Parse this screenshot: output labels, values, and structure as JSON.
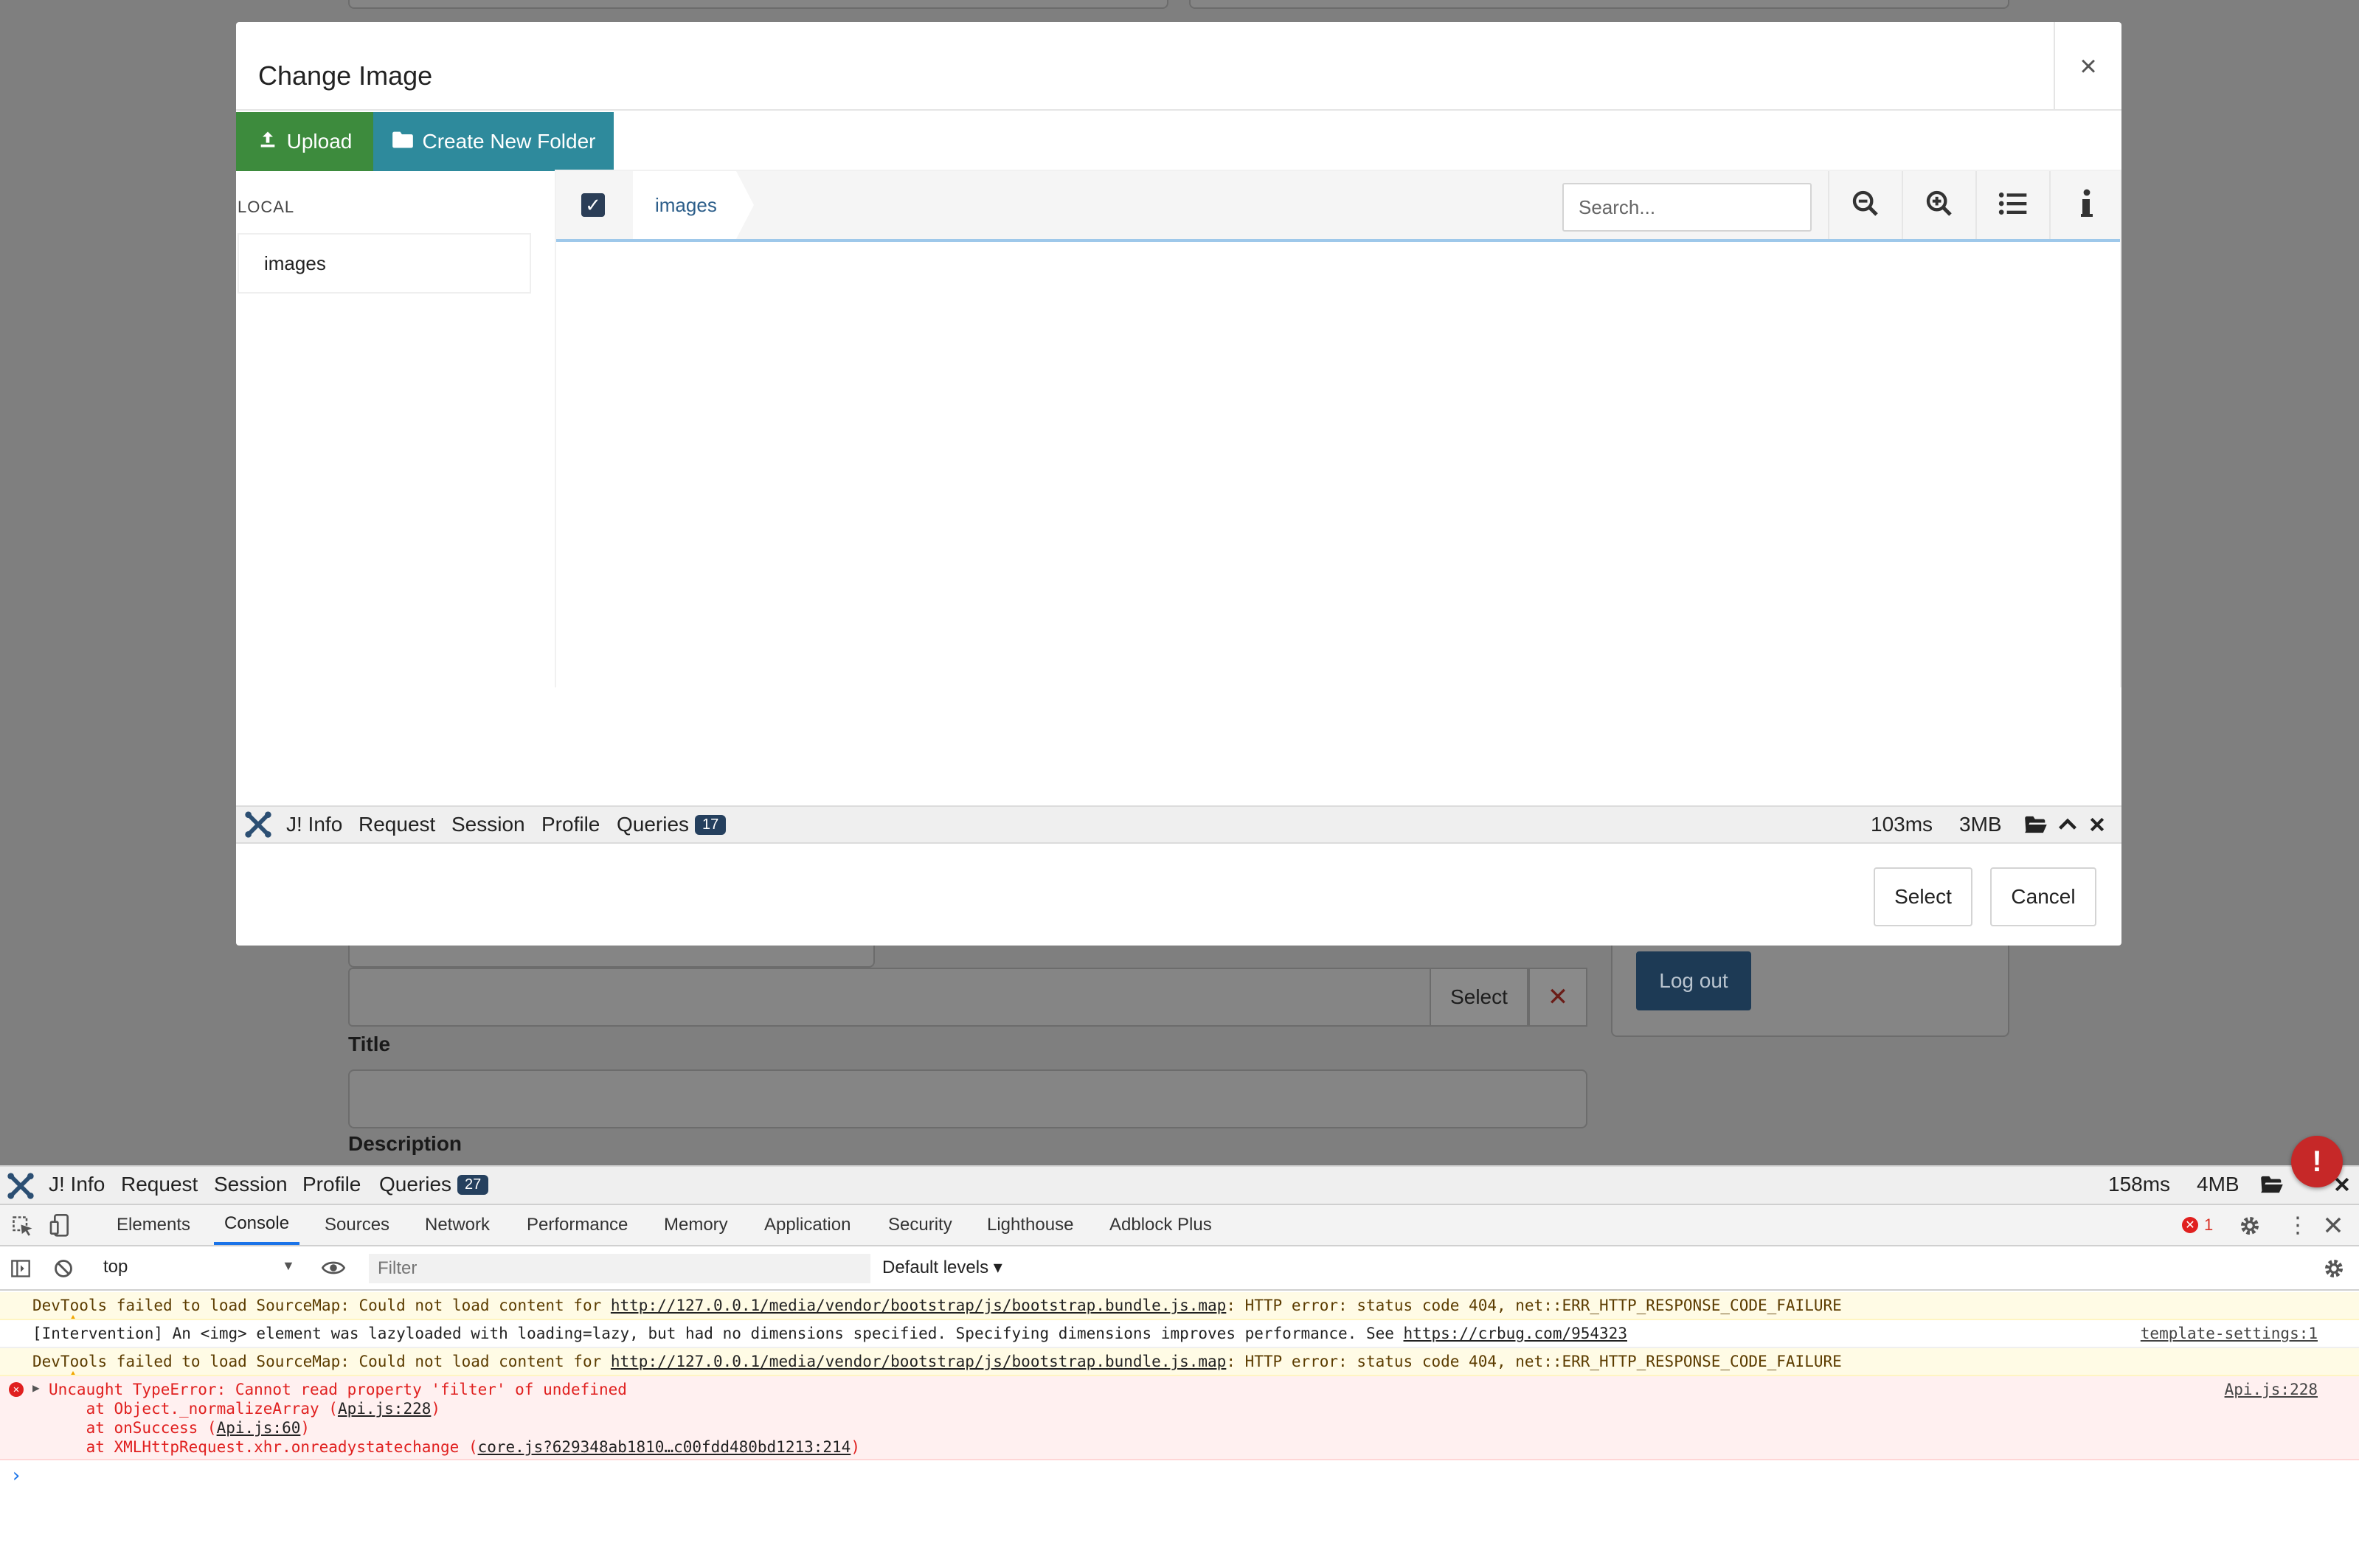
{
  "background": {
    "select_label": "Select",
    "clear_label": "✕",
    "title_label": "Title",
    "description_label": "Description",
    "logout_label": "Log out"
  },
  "modal": {
    "title": "Change Image",
    "close_label": "×",
    "upload_label": "Upload",
    "new_folder_label": "Create New Folder",
    "local_label": "LOCAL",
    "tree_item": "images",
    "breadcrumb": "images",
    "search_placeholder": "Search...",
    "select_label": "Select",
    "cancel_label": "Cancel"
  },
  "modal_debugbar": {
    "info": "J! Info",
    "request": "Request",
    "session": "Session",
    "profile": "Profile",
    "queries": "Queries",
    "queries_count": "17",
    "time": "103ms",
    "memory": "3MB"
  },
  "page_debugbar": {
    "info": "J! Info",
    "request": "Request",
    "session": "Session",
    "profile": "Profile",
    "queries": "Queries",
    "queries_count": "27",
    "time": "158ms",
    "memory": "4MB",
    "error_badge": "!"
  },
  "devtools": {
    "tabs": [
      "Elements",
      "Console",
      "Sources",
      "Network",
      "Performance",
      "Memory",
      "Application",
      "Security",
      "Lighthouse",
      "Adblock Plus"
    ],
    "active_tab": "Console",
    "error_count": "1",
    "context": "top",
    "filter_placeholder": "Filter",
    "levels": "Default levels ▾",
    "messages": {
      "m1_pre": "DevTools failed to load SourceMap: Could not load content for ",
      "m1_link": "http://127.0.0.1/media/vendor/bootstrap/js/bootstrap.bundle.js.map",
      "m1_post": ": HTTP error: status code 404, net::ERR_HTTP_RESPONSE_CODE_FAILURE",
      "m2_pre": "[Intervention] An <img> element was lazyloaded with loading=lazy, but had no dimensions specified. Specifying dimensions improves performance. See ",
      "m2_link": "https://crbug.com/954323",
      "m2_src": "template-settings:1",
      "m3_pre": "DevTools failed to load SourceMap: Could not load content for ",
      "m3_link": "http://127.0.0.1/media/vendor/bootstrap/js/bootstrap.bundle.js.map",
      "m3_post": ": HTTP error: status code 404, net::ERR_HTTP_RESPONSE_CODE_FAILURE",
      "e_main": "Uncaught TypeError: Cannot read property 'filter' of undefined",
      "e_src": "Api.js:228",
      "e_l1_pre": "    at Object._normalizeArray (",
      "e_l1_link": "Api.js:228",
      "e_l2_pre": "    at onSuccess (",
      "e_l2_link": "Api.js:60",
      "e_l3_pre": "    at XMLHttpRequest.xhr.onreadystatechange (",
      "e_l3_link": "core.js?629348ab1810…c00fdd480bd1213:214",
      "close_paren": ")"
    },
    "prompt": "›"
  },
  "colors": {
    "upload": "#3d8b3d",
    "new_folder": "#2e8a9c",
    "badge": "#25405e",
    "error": "#e0201f"
  }
}
